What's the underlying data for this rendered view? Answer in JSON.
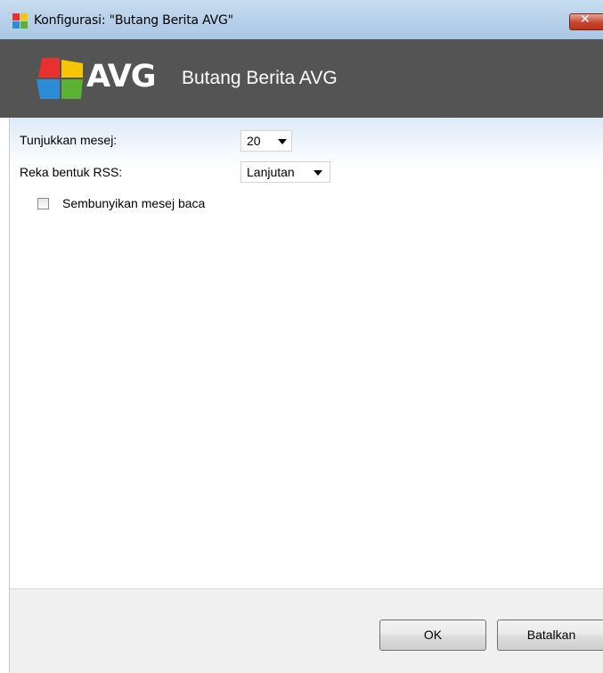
{
  "window": {
    "title": "Konfigurasi: \"Butang Berita AVG\"",
    "close_glyph": "✕",
    "icon": "avg-logo-icon"
  },
  "header": {
    "logo_text": "AVG",
    "title": "Butang Berita AVG",
    "background_color": "#545454"
  },
  "settings": {
    "show_messages": {
      "label": "Tunjukkan mesej:",
      "value": "20"
    },
    "rss_format": {
      "label": "Reka bentuk RSS:",
      "value": "Lanjutan"
    },
    "hide_read": {
      "label": "Sembunyikan mesej baca",
      "checked": false
    }
  },
  "footer": {
    "ok_label": "OK",
    "cancel_label": "Batalkan"
  }
}
